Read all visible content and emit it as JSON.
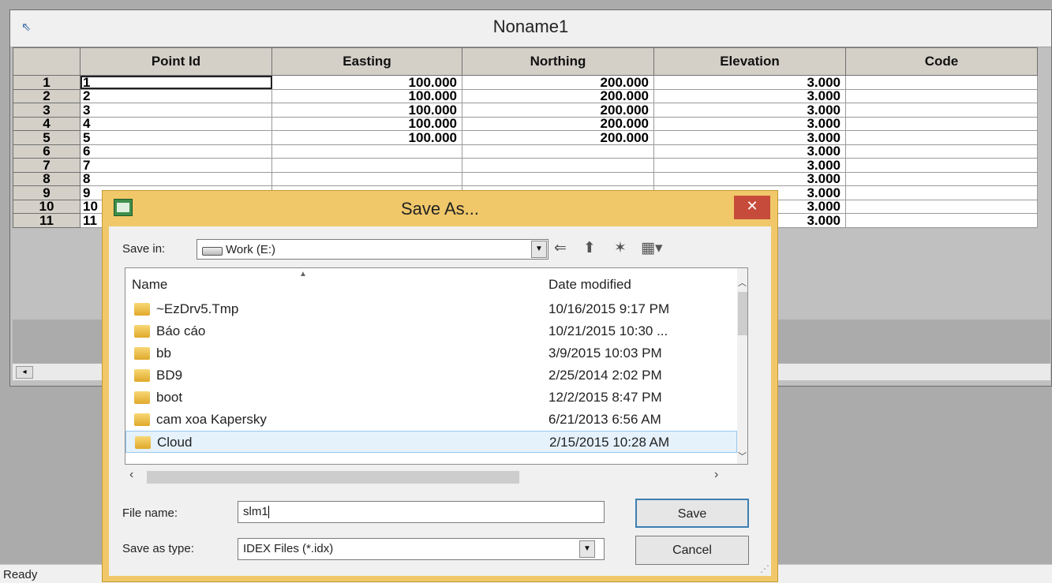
{
  "child_window": {
    "title": "Noname1",
    "sys_icon": "⇖"
  },
  "grid": {
    "headers": [
      "",
      "Point Id",
      "Easting",
      "Northing",
      "Elevation",
      "Code"
    ],
    "rows": [
      [
        "1",
        "1",
        "100.000",
        "200.000",
        "3.000",
        ""
      ],
      [
        "2",
        "2",
        "100.000",
        "200.000",
        "3.000",
        ""
      ],
      [
        "3",
        "3",
        "100.000",
        "200.000",
        "3.000",
        ""
      ],
      [
        "4",
        "4",
        "100.000",
        "200.000",
        "3.000",
        ""
      ],
      [
        "5",
        "5",
        "100.000",
        "200.000",
        "3.000",
        ""
      ],
      [
        "6",
        "6",
        "",
        "",
        "3.000",
        ""
      ],
      [
        "7",
        "7",
        "",
        "",
        "3.000",
        ""
      ],
      [
        "8",
        "8",
        "",
        "",
        "3.000",
        ""
      ],
      [
        "9",
        "9",
        "",
        "",
        "3.000",
        ""
      ],
      [
        "10",
        "10",
        "",
        "",
        "3.000",
        ""
      ],
      [
        "11",
        "11",
        "",
        "",
        "3.000",
        ""
      ]
    ],
    "scroll_left_glyph": "◂"
  },
  "status": "Ready",
  "dialog": {
    "title": "Save As...",
    "close_glyph": "✕",
    "save_in_label": "Save in:",
    "save_in_value": "Work (E:)",
    "dropdown_glyph": "▼",
    "toolbar": {
      "back_glyph": "⇐",
      "up_glyph": "⬆",
      "new_folder_glyph": "✶",
      "views_glyph": "▦▾"
    },
    "columns": {
      "name": "Name",
      "date": "Date modified",
      "sort_glyph": "▲"
    },
    "files": [
      {
        "name": "~EzDrv5.Tmp",
        "date": "10/16/2015 9:17 PM"
      },
      {
        "name": "Báo cáo",
        "date": "10/21/2015 10:30 ..."
      },
      {
        "name": "bb",
        "date": "3/9/2015 10:03 PM"
      },
      {
        "name": "BD9",
        "date": "2/25/2014 2:02 PM"
      },
      {
        "name": "boot",
        "date": "12/2/2015 8:47 PM"
      },
      {
        "name": "cam xoa Kapersky",
        "date": "6/21/2013 6:56 AM"
      },
      {
        "name": "Cloud",
        "date": "2/15/2015 10:28 AM"
      }
    ],
    "scroll_glyphs": {
      "up": "︿",
      "down": "﹀",
      "left": "‹",
      "right": "›"
    },
    "file_name_label": "File name:",
    "file_name_value": "slm1",
    "save_as_type_label": "Save as type:",
    "save_as_type_value": "IDEX Files (*.idx)",
    "save_button": "Save",
    "cancel_button": "Cancel",
    "grip_glyph": "⋰"
  }
}
